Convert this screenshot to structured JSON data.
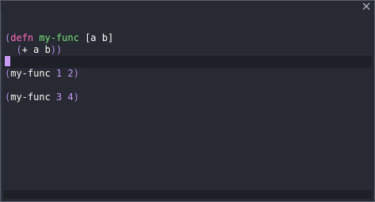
{
  "window": {
    "close_icon": "close-icon"
  },
  "code": {
    "line1": {
      "open": "(",
      "keyword": "defn",
      "name": "my-func",
      "params": "[a b]"
    },
    "line2": {
      "open": "(",
      "op": "+",
      "args": "a b",
      "close": "))"
    },
    "line4": {
      "open": "(",
      "fn": "my-func",
      "n1": "1",
      "n2": "2",
      "close": ")"
    },
    "line6": {
      "open": "(",
      "fn": "my-func",
      "n1": "3",
      "n2": "4",
      "close": ")"
    }
  },
  "colors": {
    "background": "#282a33",
    "paren": "#b78be6",
    "keyword": "#ff6dbd",
    "function_name": "#79e07c",
    "number": "#c59bf4",
    "cursor": "#c59bf4"
  }
}
